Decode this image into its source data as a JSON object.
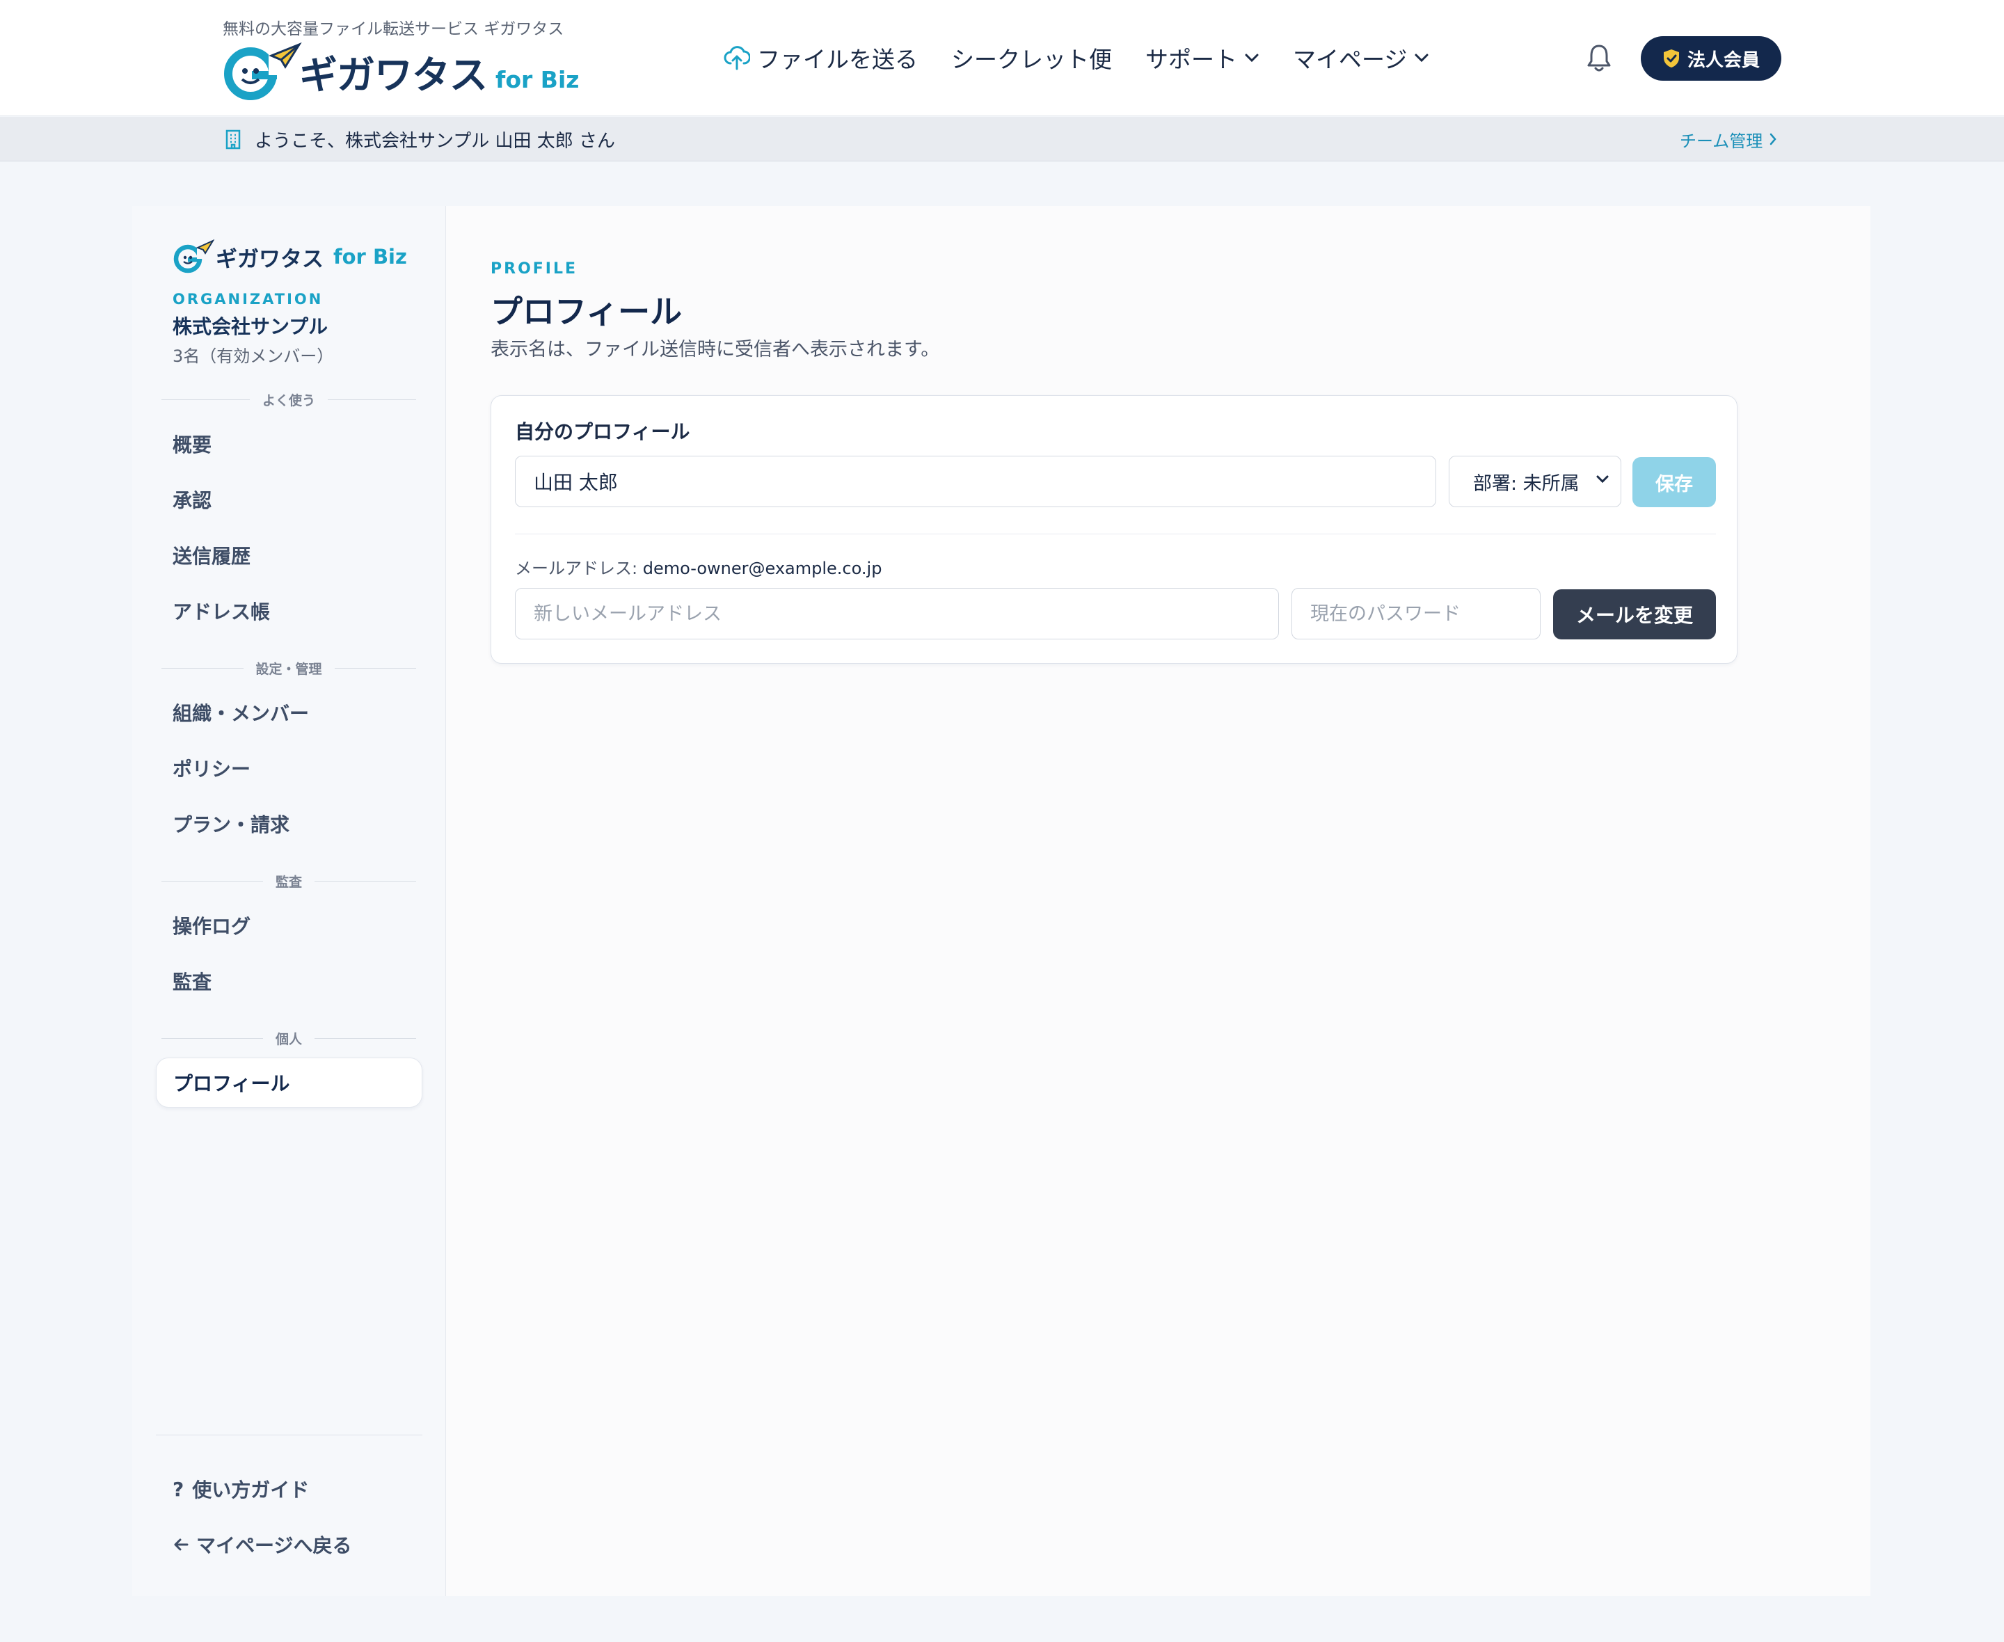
{
  "header": {
    "tagline": "無料の大容量ファイル転送サービス ギガワタス",
    "logo_text": "ギガワタス",
    "logo_biz": "for Biz",
    "nav": {
      "send": "ファイルを送る",
      "secret": "シークレット便",
      "support": "サポート",
      "mypage": "マイページ"
    },
    "corp_badge": "法人会員"
  },
  "welcome": {
    "text": "ようこそ、株式会社サンプル 山田 太郎 さん",
    "team_link": "チーム管理"
  },
  "sidebar": {
    "logo_text": "ギガワタス",
    "logo_biz": "for Biz",
    "org_label": "ORGANIZATION",
    "org_name": "株式会社サンプル",
    "org_count": "3名（有効メンバー）",
    "sections": {
      "frequent": "よく使う",
      "settings": "設定・管理",
      "audit": "監査",
      "personal": "個人"
    },
    "items": {
      "overview": "概要",
      "approval": "承認",
      "history": "送信履歴",
      "address_book": "アドレス帳",
      "org_members": "組織・メンバー",
      "policy": "ポリシー",
      "plan_billing": "プラン・請求",
      "operation_log": "操作ログ",
      "audit": "監査",
      "profile": "プロフィール"
    },
    "footer": {
      "guide": "使い方ガイド",
      "back": "マイページへ戻る"
    }
  },
  "main": {
    "eyebrow": "PROFILE",
    "title": "プロフィール",
    "description": "表示名は、ファイル送信時に受信者へ表示されます。",
    "card": {
      "title": "自分のプロフィール",
      "name_value": "山田 太郎",
      "dept_selected": "部署: 未所属",
      "save_label": "保存",
      "email_label": "メールアドレス:",
      "email_value": "demo-owner@example.co.jp",
      "new_email_placeholder": "新しいメールアドレス",
      "password_placeholder": "現在のパスワード",
      "change_email_label": "メールを変更"
    }
  },
  "colors": {
    "brand_navy": "#13284c",
    "brand_cyan": "#1aa2c6",
    "save_disabled": "#8fd3e8",
    "dark_button": "#343e50"
  }
}
